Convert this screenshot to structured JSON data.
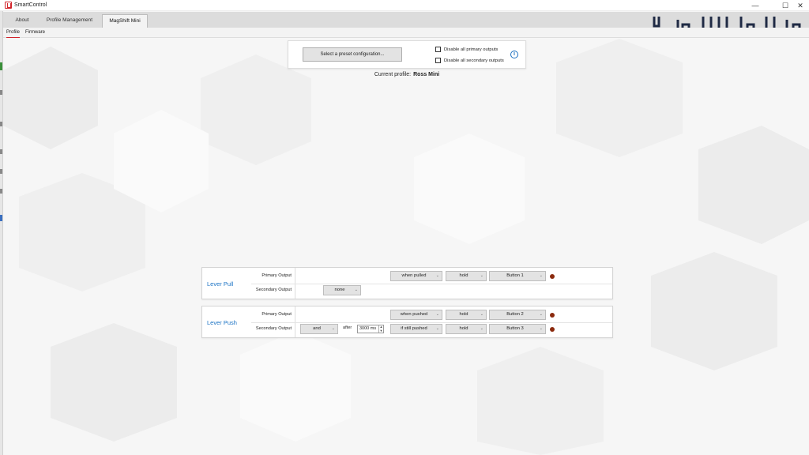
{
  "window": {
    "title": "SmartControl"
  },
  "tabs": [
    {
      "label": "About"
    },
    {
      "label": "Profile Management"
    },
    {
      "label": "MagShift Mini"
    }
  ],
  "subtabs": [
    {
      "label": "Profile"
    },
    {
      "label": "Firmware"
    }
  ],
  "preset": {
    "button_label": "Select a preset configuration...",
    "disable_primary_label": "Disable all primary outputs",
    "disable_secondary_label": "Disable all secondary outputs",
    "disable_primary_checked": false,
    "disable_secondary_checked": false,
    "info_glyph": "i"
  },
  "current_profile": {
    "label": "Current profile:",
    "name": "Ross Mini"
  },
  "lever_pull": {
    "title": "Lever Pull",
    "primary_label": "Primary Output",
    "secondary_label": "Secondary Output",
    "primary": {
      "trigger": "when pulled",
      "mode": "hold",
      "button": "Button 1"
    },
    "secondary": {
      "condition": "none"
    }
  },
  "lever_push": {
    "title": "Lever Push",
    "primary_label": "Primary Output",
    "secondary_label": "Secondary Output",
    "primary": {
      "trigger": "when pushed",
      "mode": "hold",
      "button": "Button 2"
    },
    "secondary": {
      "condition": "and",
      "after_label": "after",
      "delay": "3000 ms",
      "trigger": "if still pushed",
      "mode": "hold",
      "button": "Button 3"
    }
  },
  "icons": {
    "chevron": "⌄",
    "spin_up": "▲",
    "spin_down": "▼",
    "minimize": "—",
    "maximize": "☐",
    "close": "✕"
  },
  "colors": {
    "accent_red": "#d2232a",
    "link_blue": "#1a72c4",
    "led": "#8b2a0e"
  }
}
